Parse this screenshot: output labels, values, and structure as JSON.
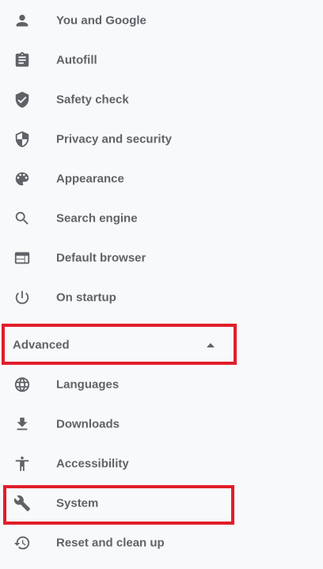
{
  "sidebar": {
    "items": [
      {
        "label": "You and Google",
        "icon": "person-icon"
      },
      {
        "label": "Autofill",
        "icon": "clipboard-icon"
      },
      {
        "label": "Safety check",
        "icon": "shield-check-icon"
      },
      {
        "label": "Privacy and security",
        "icon": "shield-half-icon"
      },
      {
        "label": "Appearance",
        "icon": "palette-icon"
      },
      {
        "label": "Search engine",
        "icon": "search-icon"
      },
      {
        "label": "Default browser",
        "icon": "browser-window-icon"
      },
      {
        "label": "On startup",
        "icon": "power-icon"
      }
    ],
    "advanced": {
      "label": "Advanced",
      "expanded": true,
      "icon": "caret-up-icon"
    },
    "advanced_items": [
      {
        "label": "Languages",
        "icon": "globe-icon"
      },
      {
        "label": "Downloads",
        "icon": "download-icon"
      },
      {
        "label": "Accessibility",
        "icon": "accessibility-icon"
      },
      {
        "label": "System",
        "icon": "wrench-icon"
      },
      {
        "label": "Reset and clean up",
        "icon": "history-reset-icon"
      }
    ]
  },
  "highlight_color": "#e01e2a",
  "highlighted": [
    "Advanced",
    "System"
  ]
}
